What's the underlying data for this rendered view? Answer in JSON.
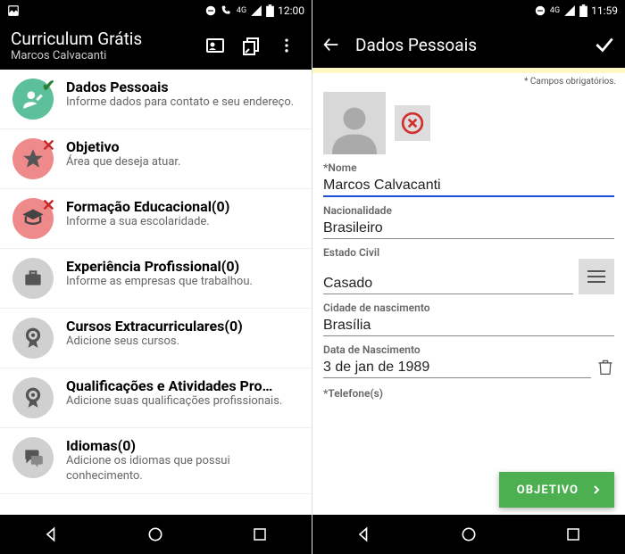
{
  "left": {
    "status": {
      "time": "12:00"
    },
    "appbar": {
      "title": "Curriculum Grátis",
      "subtitle": "Marcos Calvacanti"
    },
    "items": [
      {
        "title": "Dados Pessoais",
        "sub": "Informe dados para contato e seu endereço."
      },
      {
        "title": "Objetivo",
        "sub": "Área que deseja atuar."
      },
      {
        "title": "Formação Educacional(0)",
        "sub": "Informe a sua escolaridade."
      },
      {
        "title": "Experiência Profissional(0)",
        "sub": "Informe as empresas que trabalhou."
      },
      {
        "title": "Cursos Extracurriculares(0)",
        "sub": "Adicione seus cursos."
      },
      {
        "title": "Qualificações e Atividades Pro…",
        "sub": "Adicione suas qualificações profissionais."
      },
      {
        "title": "Idiomas(0)",
        "sub": "Adicione os idiomas que possui conhecimento."
      }
    ]
  },
  "right": {
    "status": {
      "time": "11:59"
    },
    "appbar": {
      "title": "Dados Pessoais"
    },
    "required_note": "* Campos obrigatórios.",
    "labels": {
      "nome": "*Nome",
      "nacionalidade": "Nacionalidade",
      "estado": "Estado Civil",
      "cidade": "Cidade de nascimento",
      "data": "Data de Nascimento",
      "tel": "*Telefone(s)"
    },
    "values": {
      "nome": "Marcos Calvacanti",
      "nacionalidade": "Brasileiro",
      "estado": "Casado",
      "cidade": "Brasília",
      "data": "3 de jan de 1989"
    },
    "fab": "OBJETIVO"
  }
}
